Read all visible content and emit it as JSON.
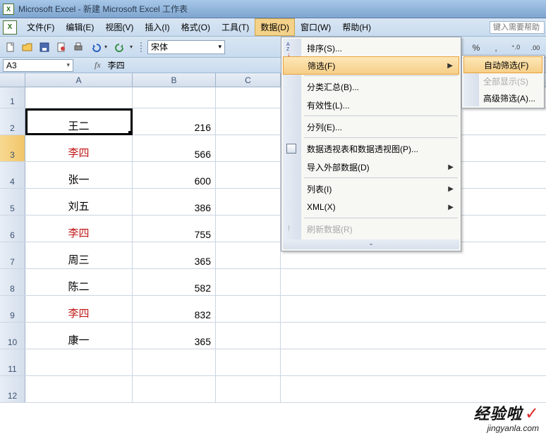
{
  "title": "Microsoft Excel - 新建 Microsoft Excel 工作表",
  "menubar": {
    "file": "文件(F)",
    "edit": "编辑(E)",
    "view": "视图(V)",
    "insert": "插入(I)",
    "format": "格式(O)",
    "tools": "工具(T)",
    "data": "数据(D)",
    "window": "窗口(W)",
    "help": "帮助(H)"
  },
  "help_box_placeholder": "键入需要帮助",
  "toolbar": {
    "font_name": "宋体",
    "percent": "%",
    "comma": ",",
    "dec_inc": "⁺.0",
    "dec_dec": ".00"
  },
  "formula_bar": {
    "name_box": "A3",
    "fx": "fx",
    "value": "李四"
  },
  "columns": {
    "A": "A",
    "B": "B",
    "C": "C"
  },
  "rows": [
    "1",
    "2",
    "3",
    "4",
    "5",
    "6",
    "7",
    "8",
    "9",
    "10",
    "11",
    "12"
  ],
  "cells": {
    "r2": {
      "a": "王二",
      "b": "216"
    },
    "r3": {
      "a": "李四",
      "b": "566"
    },
    "r4": {
      "a": "张一",
      "b": "600"
    },
    "r5": {
      "a": "刘五",
      "b": "386"
    },
    "r6": {
      "a": "李四",
      "b": "755"
    },
    "r7": {
      "a": "周三",
      "b": "365"
    },
    "r8": {
      "a": "陈二",
      "b": "582"
    },
    "r9": {
      "a": "李四",
      "b": "832"
    },
    "r10": {
      "a": "康一",
      "b": "365"
    }
  },
  "chart_data": {
    "type": "table",
    "columns": [
      "A",
      "B"
    ],
    "rows": [
      [
        "王二",
        216
      ],
      [
        "李四",
        566
      ],
      [
        "张一",
        600
      ],
      [
        "刘五",
        386
      ],
      [
        "李四",
        755
      ],
      [
        "周三",
        365
      ],
      [
        "陈二",
        582
      ],
      [
        "李四",
        832
      ],
      [
        "康一",
        365
      ]
    ]
  },
  "data_menu": {
    "sort": "排序(S)...",
    "filter": "筛选(F)",
    "subtotal": "分类汇总(B)...",
    "validation": "有效性(L)...",
    "text_to_cols": "分列(E)...",
    "pivot": "数据透视表和数据透视图(P)...",
    "import": "导入外部数据(D)",
    "list": "列表(I)",
    "xml": "XML(X)",
    "refresh": "刷新数据(R)"
  },
  "filter_submenu": {
    "autofilter": "自动筛选(F)",
    "show_all": "全部显示(S)",
    "advanced": "高级筛选(A)..."
  },
  "watermark": {
    "top": "经验啦",
    "check": "✓",
    "sub": "jingyanla.com"
  }
}
